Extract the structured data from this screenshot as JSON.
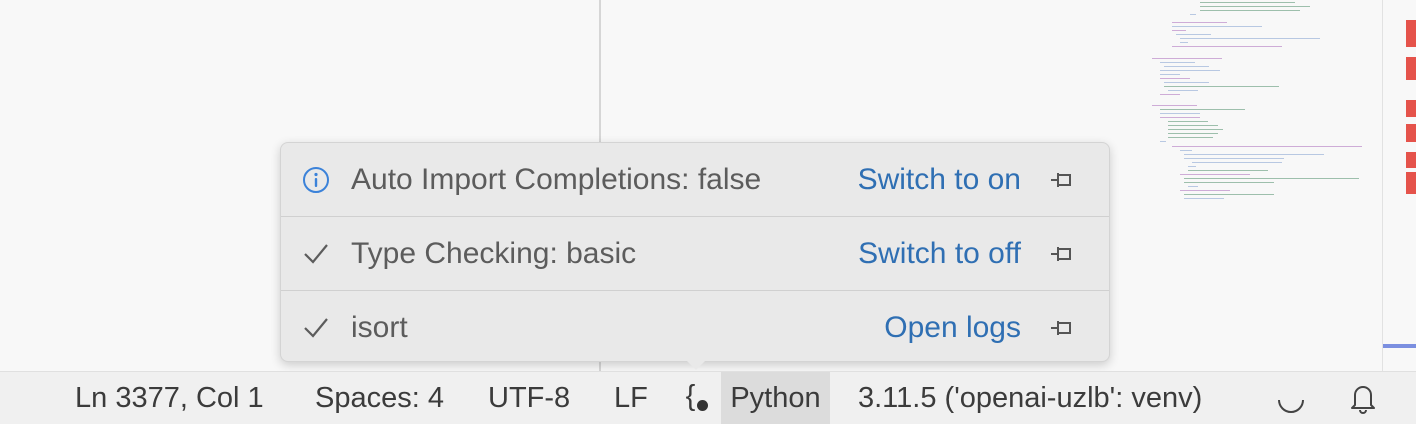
{
  "language_status": {
    "items": [
      {
        "label": "Auto Import Completions: false",
        "action": "Switch to on",
        "icon": "info-icon"
      },
      {
        "label": "Type Checking: basic",
        "action": "Switch to off",
        "icon": "check-icon"
      },
      {
        "label": "isort",
        "action": "Open logs",
        "icon": "check-icon"
      }
    ]
  },
  "statusbar": {
    "position": "Ln 3377, Col 1",
    "indentation": "Spaces: 4",
    "encoding": "UTF-8",
    "eol": "LF",
    "language_status_icon": "{",
    "language": "Python",
    "interpreter": "3.11.5 ('openai-uzlb': venv)",
    "spinner_icon": "loading-spinner-icon",
    "notifications_icon": "bell-icon"
  },
  "colors": {
    "accent_link": "#2f6fb3",
    "info_icon": "#3b82d9",
    "ruler_error": "#e5534b"
  }
}
